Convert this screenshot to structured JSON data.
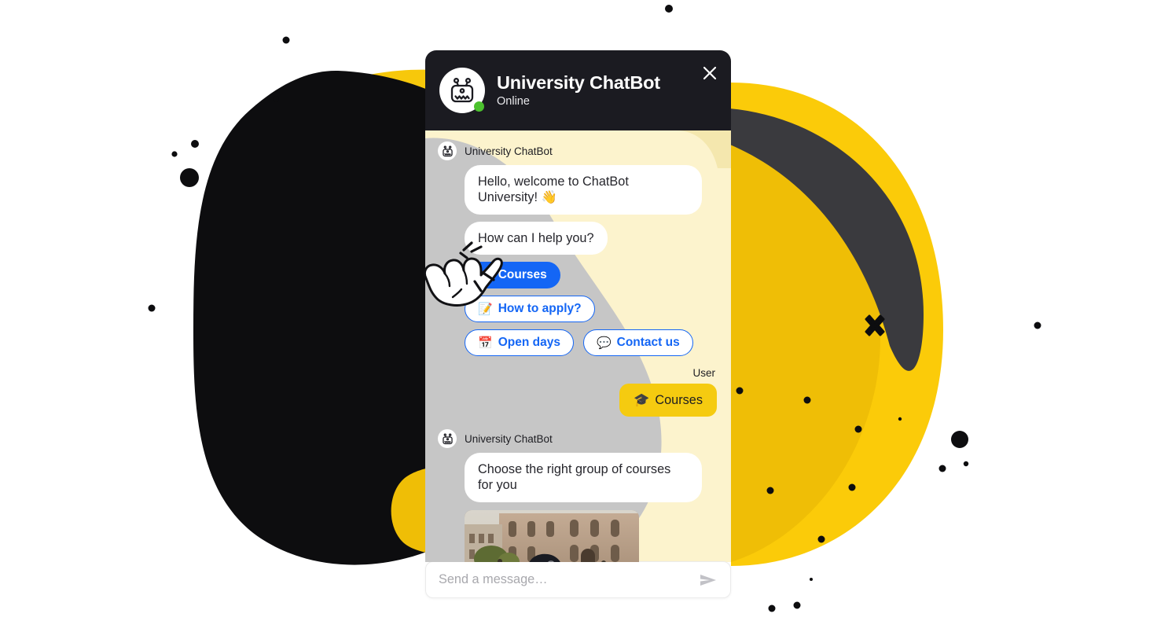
{
  "header": {
    "title": "University ChatBot",
    "status": "Online",
    "avatar_icon": "robot-icon",
    "close_icon": "close-icon",
    "online_indicator": "online-status-dot"
  },
  "conversation": [
    {
      "type": "bot_group",
      "sender": "University ChatBot",
      "avatar_icon": "robot-icon",
      "messages": [
        "Hello, welcome to ChatBot University! 👋",
        "How can I help you?"
      ]
    },
    {
      "type": "quick_replies",
      "options": [
        {
          "label": "Courses",
          "emoji": "🎓",
          "icon": "graduation-cap-icon",
          "selected": true
        },
        {
          "label": "How to apply?",
          "emoji": "📝",
          "icon": "memo-icon",
          "selected": false
        },
        {
          "label": "Open days",
          "emoji": "📅",
          "icon": "calendar-icon",
          "selected": false
        },
        {
          "label": "Contact us",
          "emoji": "💬",
          "icon": "speech-balloon-icon",
          "selected": false
        }
      ]
    },
    {
      "type": "user_group",
      "sender": "User",
      "message": "Courses",
      "emoji": "🎓"
    },
    {
      "type": "bot_group",
      "sender": "University ChatBot",
      "avatar_icon": "robot-icon",
      "messages": [
        "Choose the right group of courses for you"
      ],
      "attachment": {
        "type": "image",
        "alt": "Student in a dark cap and blue jacket on a university lawn in front of a classical stone building"
      }
    }
  ],
  "composer": {
    "placeholder": "Send a message…",
    "value": "",
    "send_icon": "send-icon"
  },
  "colors": {
    "header_bg": "#1b1b21",
    "body_bg": "#FCF3CD",
    "accent_blue": "#1466f5",
    "accent_yellow": "#F5CB10",
    "online_green": "#4CC22E",
    "overlay_gray": "#C6C6C6",
    "dark_blob": "#3a3a3e",
    "black_blob": "#0d0d0f"
  }
}
